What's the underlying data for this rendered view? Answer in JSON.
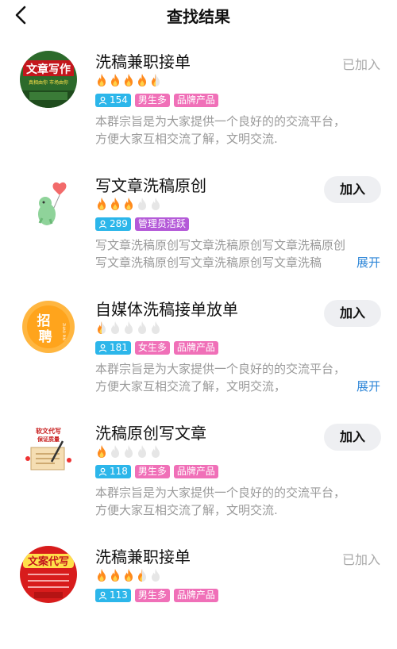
{
  "header": {
    "title": "查找结果"
  },
  "groups": [
    {
      "name": "洗稿兼职接单",
      "flames": [
        1,
        1,
        1,
        1,
        0.5
      ],
      "members": "154",
      "tags": [
        {
          "text": "男生多",
          "color": "pink"
        },
        {
          "text": "品牌产品",
          "color": "pink"
        }
      ],
      "description": "本群宗旨是为大家提供一个良好的的交流平台，\n方便大家互相交流了解，文明交流.",
      "status": "已加入",
      "joined": true,
      "expand": ""
    },
    {
      "name": "写文章洗稿原创",
      "flames": [
        1,
        1,
        1,
        0,
        0
      ],
      "members": "289",
      "tags": [
        {
          "text": "管理员活跃",
          "color": "purple"
        }
      ],
      "description": "写文章洗稿原创写文章洗稿原创写文章洗稿原创\n写文章洗稿原创写文章洗稿原创写文章洗稿",
      "status": "加入",
      "joined": false,
      "expand": "展开"
    },
    {
      "name": "自媒体洗稿接单放单",
      "flames": [
        0.5,
        0,
        0,
        0,
        0
      ],
      "members": "181",
      "tags": [
        {
          "text": "女生多",
          "color": "pink"
        },
        {
          "text": "品牌产品",
          "color": "pink"
        }
      ],
      "description": "本群宗旨是为大家提供一个良好的的交流平台，\n方便大家互相交流了解，文明交流，",
      "status": "加入",
      "joined": false,
      "expand": "展开"
    },
    {
      "name": "洗稿原创写文章",
      "flames": [
        1,
        0,
        0,
        0,
        0
      ],
      "members": "118",
      "tags": [
        {
          "text": "男生多",
          "color": "pink"
        },
        {
          "text": "品牌产品",
          "color": "pink"
        }
      ],
      "description": "本群宗旨是为大家提供一个良好的的交流平台，\n方便大家互相交流了解，文明交流.",
      "status": "加入",
      "joined": false,
      "expand": ""
    },
    {
      "name": "洗稿兼职接单",
      "flames": [
        1,
        1,
        1,
        0.5,
        0
      ],
      "members": "113",
      "tags": [
        {
          "text": "男生多",
          "color": "pink"
        },
        {
          "text": "品牌产品",
          "color": "pink"
        }
      ],
      "description": "",
      "status": "已加入",
      "joined": true,
      "expand": ""
    }
  ],
  "avatars": [
    {
      "lettering": "文章写作",
      "sub": "真相由你 市场由你",
      "icon": "article-writing-logo"
    },
    {
      "icon": "dinosaur-balloon-logo"
    },
    {
      "lettering": "招聘",
      "sub": "ZHAO PIN",
      "icon": "recruiting-badge-logo"
    },
    {
      "lettering": "软文代写",
      "sub": "保证质量",
      "icon": "copywriting-logo"
    },
    {
      "lettering": "文案代写",
      "icon": "copy-service-logo"
    }
  ],
  "colors": {
    "accent": "#2f87d8",
    "flame": "#ff8a1c",
    "flame_off": "#e6e6e6",
    "members_tag": "#2cb6ea",
    "pink_tag": "#f070b8",
    "purple_tag": "#b45ad8"
  }
}
